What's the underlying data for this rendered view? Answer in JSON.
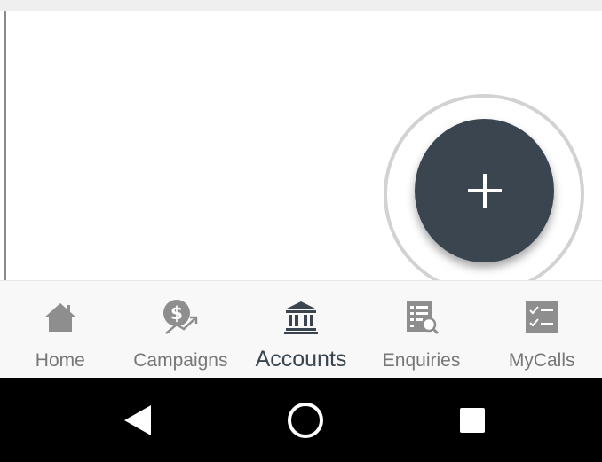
{
  "fab": {
    "icon": "plus-icon",
    "color": "#3a4550"
  },
  "bottom_nav": {
    "active_index": 2,
    "items": [
      {
        "label": "Home",
        "icon": "home-icon"
      },
      {
        "label": "Campaigns",
        "icon": "campaign-money-icon"
      },
      {
        "label": "Accounts",
        "icon": "bank-icon"
      },
      {
        "label": "Enquiries",
        "icon": "enquiry-search-icon"
      },
      {
        "label": "MyCalls",
        "icon": "checklist-icon"
      }
    ]
  },
  "system_nav": {
    "buttons": [
      "back-icon",
      "home-circle-icon",
      "recents-square-icon"
    ]
  },
  "colors": {
    "accent": "#3a4550",
    "inactive_label": "#777777",
    "nav_background": "#f8f8f8",
    "system_bar": "#000000"
  }
}
